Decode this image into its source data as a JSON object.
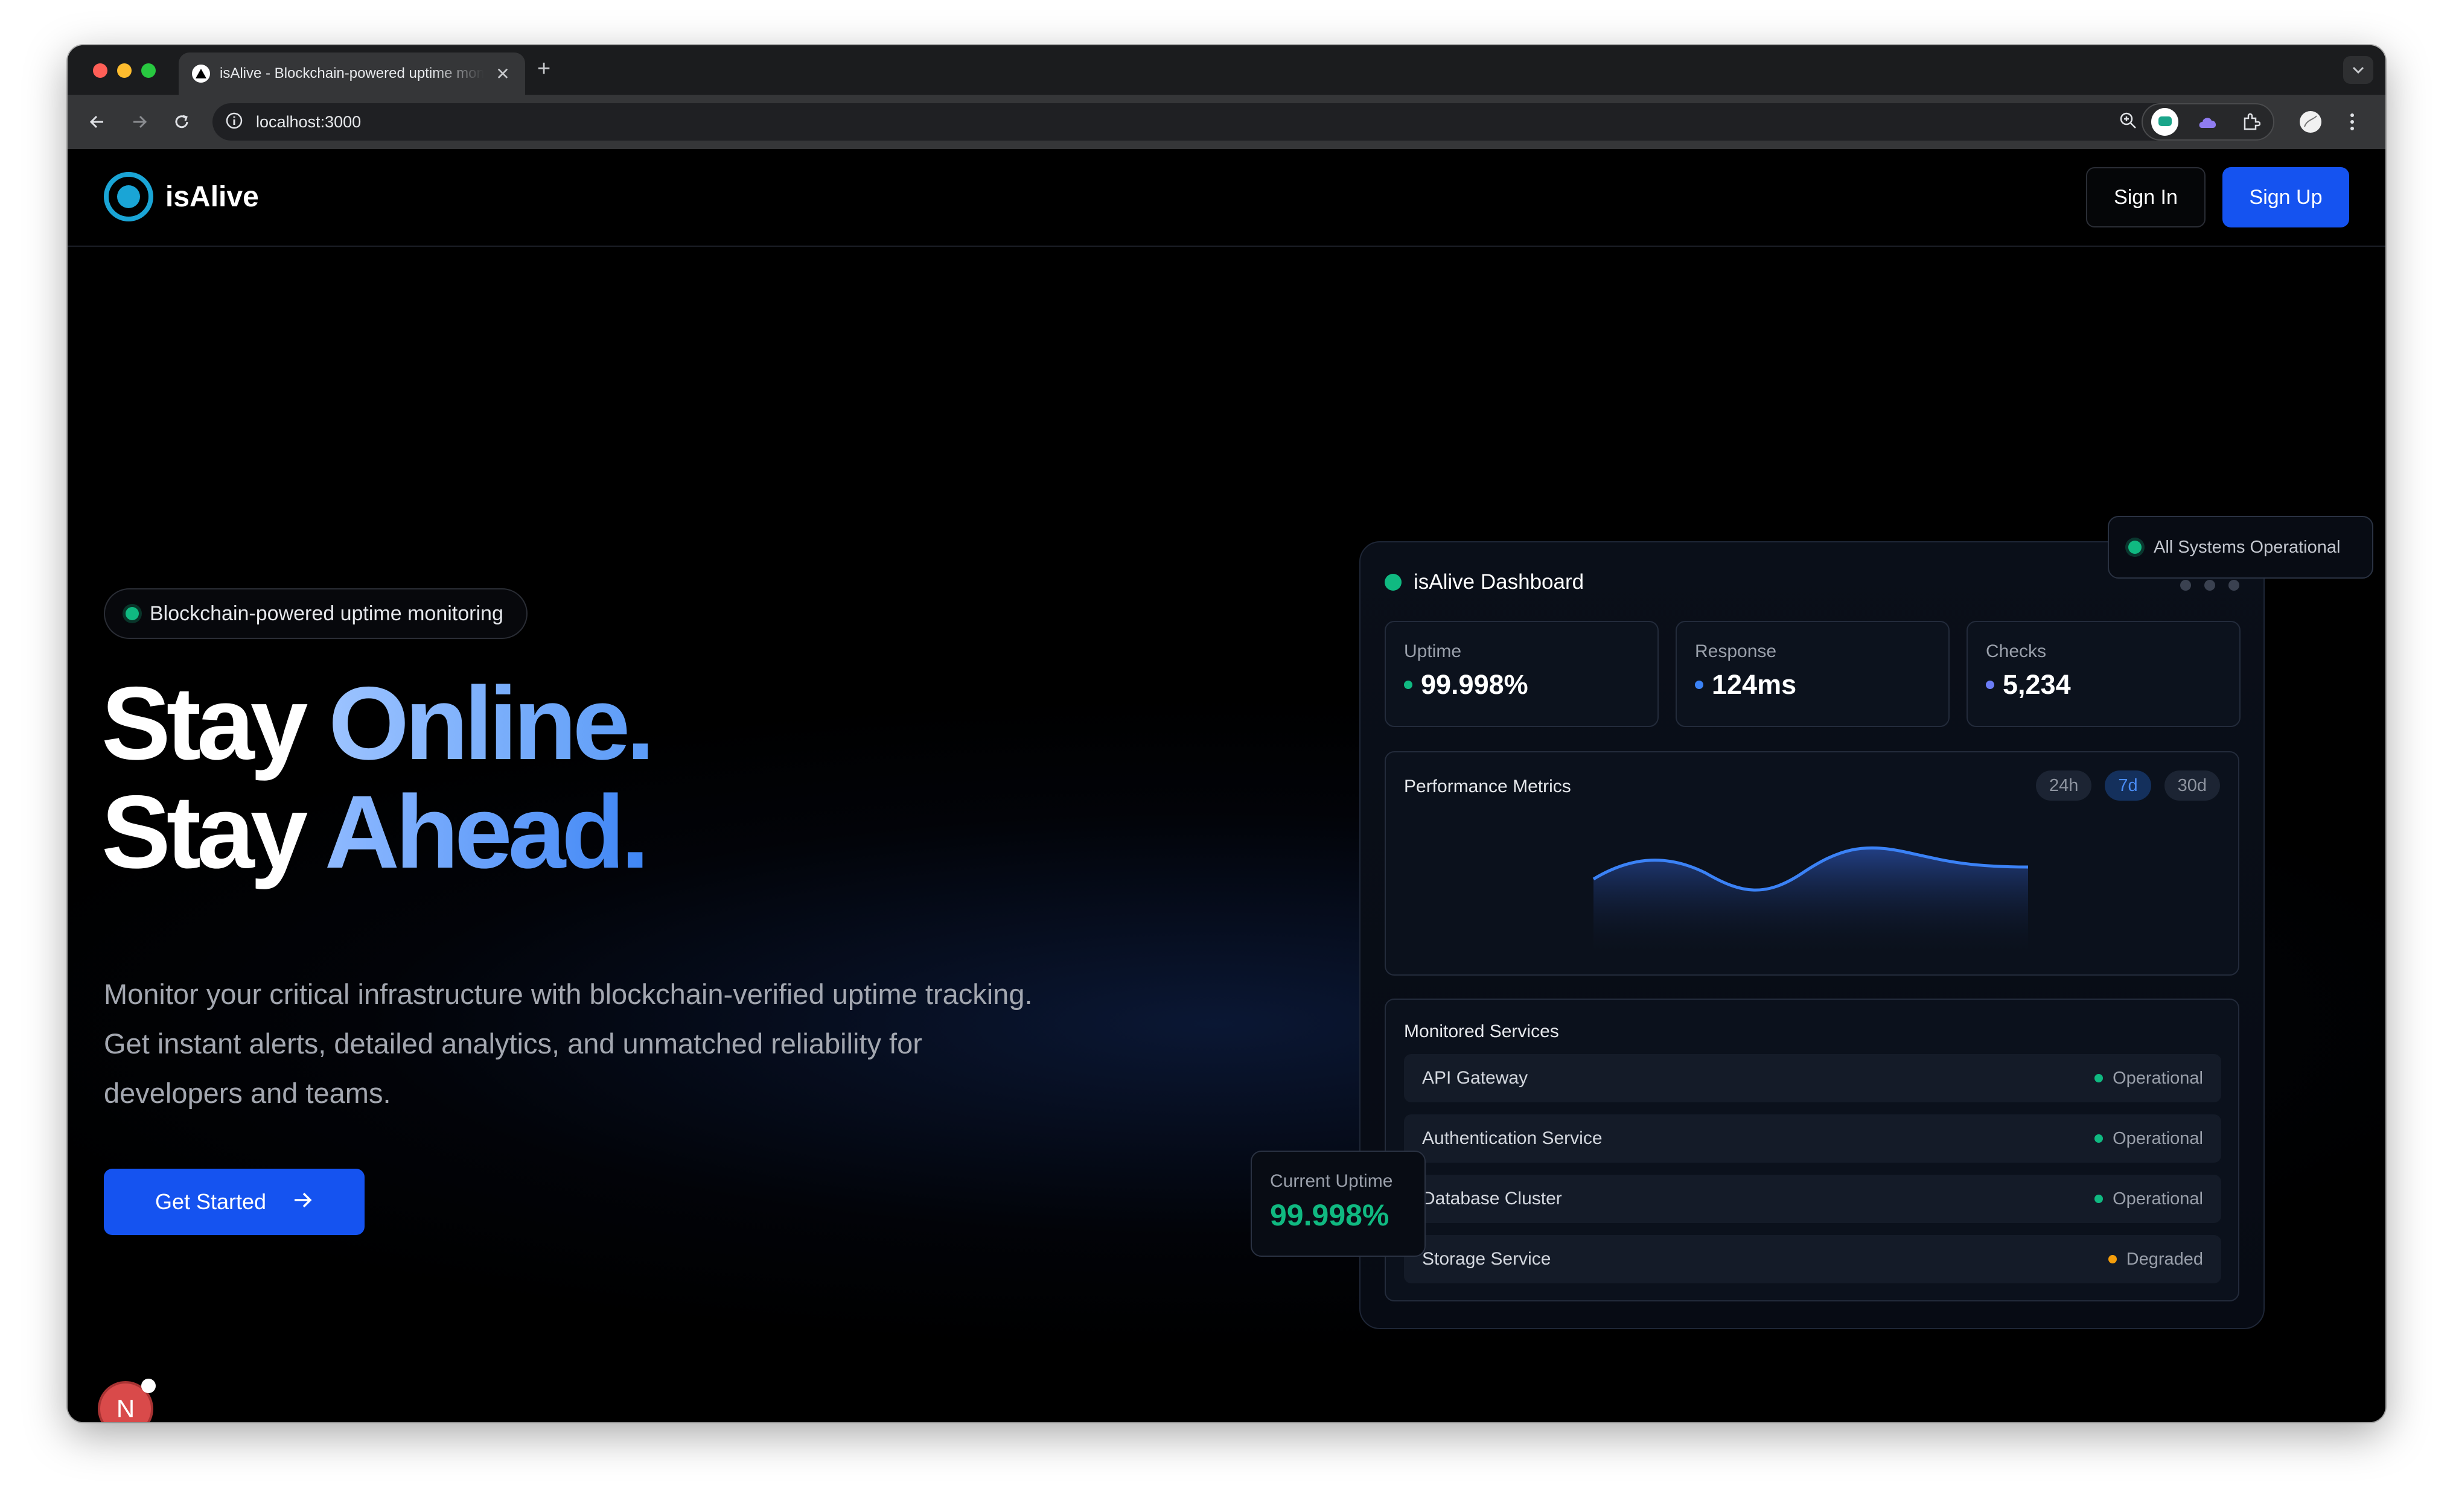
{
  "browser": {
    "tab_title": "isAlive - Blockchain-powered uptime monitoring",
    "url": "localhost:3000"
  },
  "nav": {
    "brand": "isAlive",
    "sign_in": "Sign In",
    "sign_up": "Sign Up"
  },
  "hero": {
    "badge": "Blockchain-powered uptime monitoring",
    "line1_white": "Stay",
    "line1_gradient": "Online.",
    "line2_white": "Stay",
    "line2_gradient": "Ahead.",
    "description": "Monitor your critical infrastructure with blockchain-verified uptime tracking. Get instant alerts, detailed analytics, and unmatched reliability for developers and teams.",
    "cta": "Get Started",
    "dev_badge": "N"
  },
  "status_pill": "All Systems Operational",
  "dashboard": {
    "title": "isAlive Dashboard",
    "stats": [
      {
        "label": "Uptime",
        "value": "99.998%",
        "dot": "#10b981"
      },
      {
        "label": "Response",
        "value": "124ms",
        "dot": "#3b82f6"
      },
      {
        "label": "Checks",
        "value": "5,234",
        "dot": "#6b7cf6"
      }
    ],
    "performance": {
      "title": "Performance Metrics",
      "ranges": [
        "24h",
        "7d",
        "30d"
      ],
      "active_range": "7d"
    },
    "services": {
      "title": "Monitored Services",
      "items": [
        {
          "name": "API Gateway",
          "status": "Operational",
          "color": "#10b981"
        },
        {
          "name": "Authentication Service",
          "status": "Operational",
          "color": "#10b981"
        },
        {
          "name": "Database Cluster",
          "status": "Operational",
          "color": "#10b981"
        },
        {
          "name": "Storage Service",
          "status": "Degraded",
          "color": "#f59e0b"
        }
      ]
    }
  },
  "uptime_card": {
    "label": "Current Uptime",
    "value": "99.998%"
  },
  "colors": {
    "accent": "#1553f0",
    "success": "#10b981",
    "warning": "#f59e0b",
    "logo": "#1aa5d6"
  }
}
